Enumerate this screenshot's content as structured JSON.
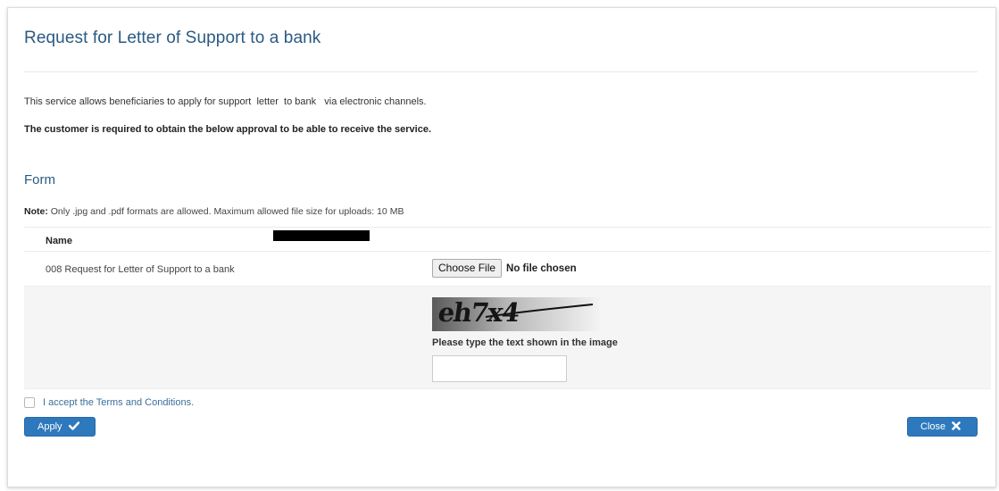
{
  "page": {
    "title": "Request for Letter of Support to a bank",
    "description": "This service allows beneficiaries to apply for support  letter  to bank   via electronic channels.",
    "requirement": "The customer is required to obtain the below approval to be able to receive the service."
  },
  "form": {
    "heading": "Form",
    "note_label": "Note:",
    "note_text": " Only .jpg and .pdf formats are allowed. Maximum allowed file size for uploads: 10 MB",
    "name_label": "Name",
    "upload_label": "008 Request for Letter of Support to a bank",
    "choose_file_label": "Choose File",
    "file_status": "No file chosen"
  },
  "captcha": {
    "image_text": "eh7x4",
    "prompt": "Please type the text shown in the image",
    "value": ""
  },
  "terms": {
    "label": "I accept the Terms and Conditions.",
    "checked": false
  },
  "actions": {
    "apply_label": "Apply",
    "apply_icon": "checkmark-icon",
    "close_label": "Close",
    "close_icon": "x-icon"
  },
  "colors": {
    "title": "#2a5a84",
    "button": "#2e79bd",
    "link": "#3a6e9a"
  }
}
